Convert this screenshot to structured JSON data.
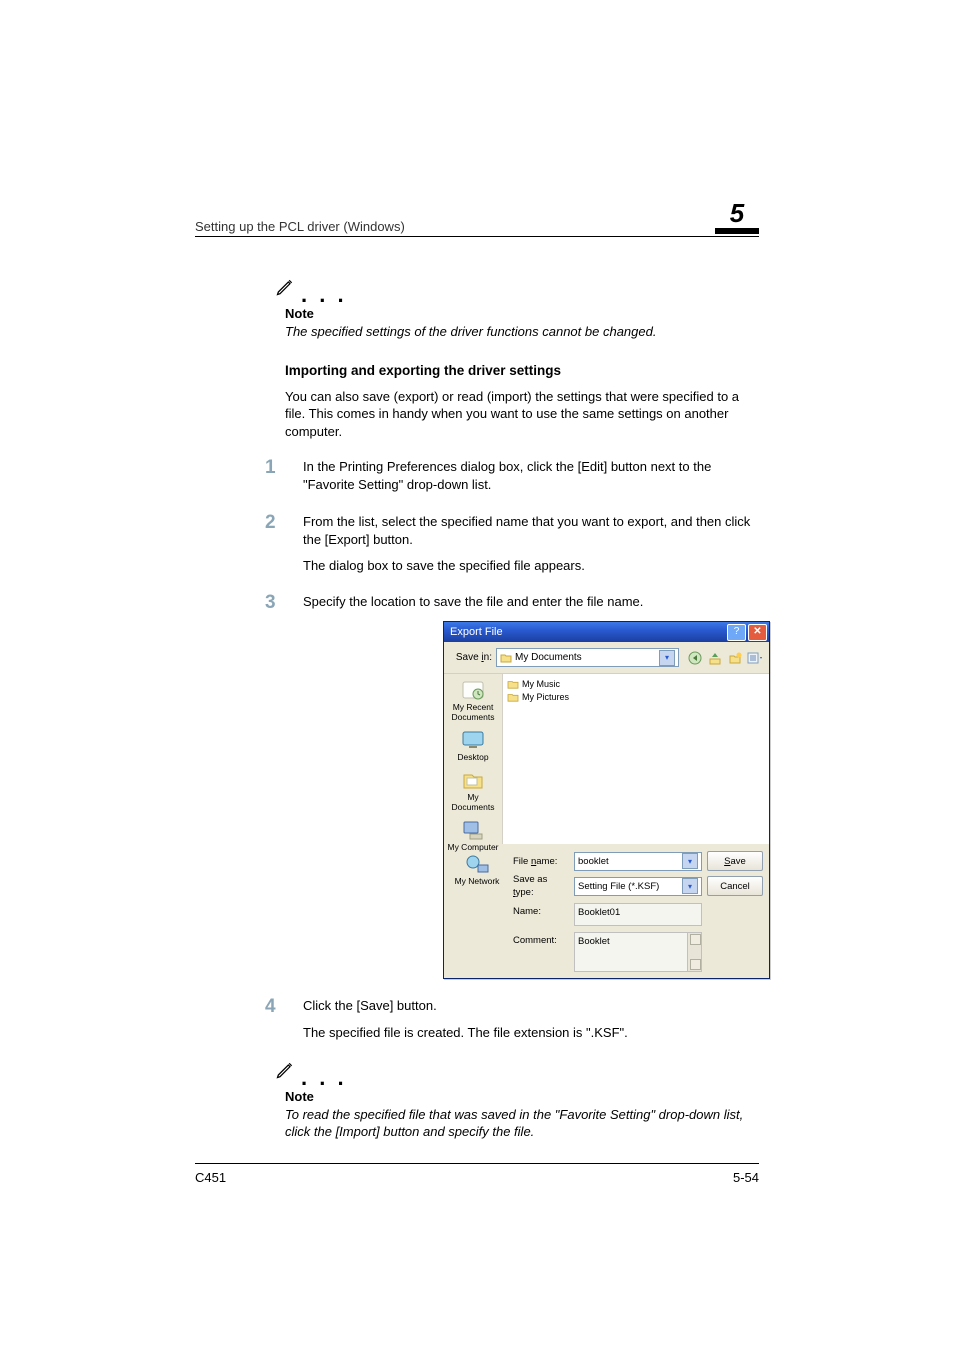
{
  "header": {
    "section_title": "Setting up the PCL driver (Windows)",
    "chapter_number": "5"
  },
  "notes": {
    "label": "Note",
    "top_body": "The specified settings of the driver functions cannot be changed.",
    "bottom_body": "To read the specified file that was saved in the \"Favorite Setting\" drop-down list, click the [Import] button and specify the file."
  },
  "subheading": "Importing and exporting the driver settings",
  "intro": "You can also save (export) or read (import) the settings that were specified to a file. This comes in handy when you want to use the same settings on another computer.",
  "steps": {
    "s1": "In the Printing Preferences dialog box, click the [Edit] button next to the \"Favorite Setting\" drop-down list.",
    "s2": "From the list, select the specified name that you want to export, and then click the [Export] button.",
    "s2_sub": "The dialog box to save the specified file appears.",
    "s3": "Specify the location to save the file and enter the file name.",
    "s4": "Click the [Save] button.",
    "s4_sub": "The specified file is created. The file extension is \".KSF\"."
  },
  "dialog": {
    "title": "Export File",
    "savein_label_pre": "Save ",
    "savein_label_ul": "i",
    "savein_label_post": "n:",
    "savein_value": "My Documents",
    "toolbar_icons": [
      "back-icon",
      "up-icon",
      "new-folder-icon",
      "views-icon"
    ],
    "places": [
      {
        "label": "My Recent Documents",
        "icon": "recent"
      },
      {
        "label": "Desktop",
        "icon": "desktop"
      },
      {
        "label": "My Documents",
        "icon": "mydocs"
      },
      {
        "label": "My Computer",
        "icon": "mycomputer"
      }
    ],
    "bottom_place": {
      "label": "My Network",
      "icon": "mynetwork"
    },
    "folders": [
      "My Music",
      "My Pictures"
    ],
    "fields": {
      "filename_label_pre": "File ",
      "filename_label_ul": "n",
      "filename_label_post": "ame:",
      "filename_value": "booklet",
      "saveastype_label_pre": "Save as ",
      "saveastype_label_ul": "t",
      "saveastype_label_post": "ype:",
      "saveastype_value": "Setting File (*.KSF)",
      "name_label": "Name:",
      "name_value": "Booklet01",
      "comment_label": "Comment:",
      "comment_value": "Booklet"
    },
    "buttons": {
      "save_ul": "S",
      "save_rest": "ave",
      "cancel": "Cancel"
    }
  },
  "footer": {
    "model": "C451",
    "page": "5-54"
  }
}
